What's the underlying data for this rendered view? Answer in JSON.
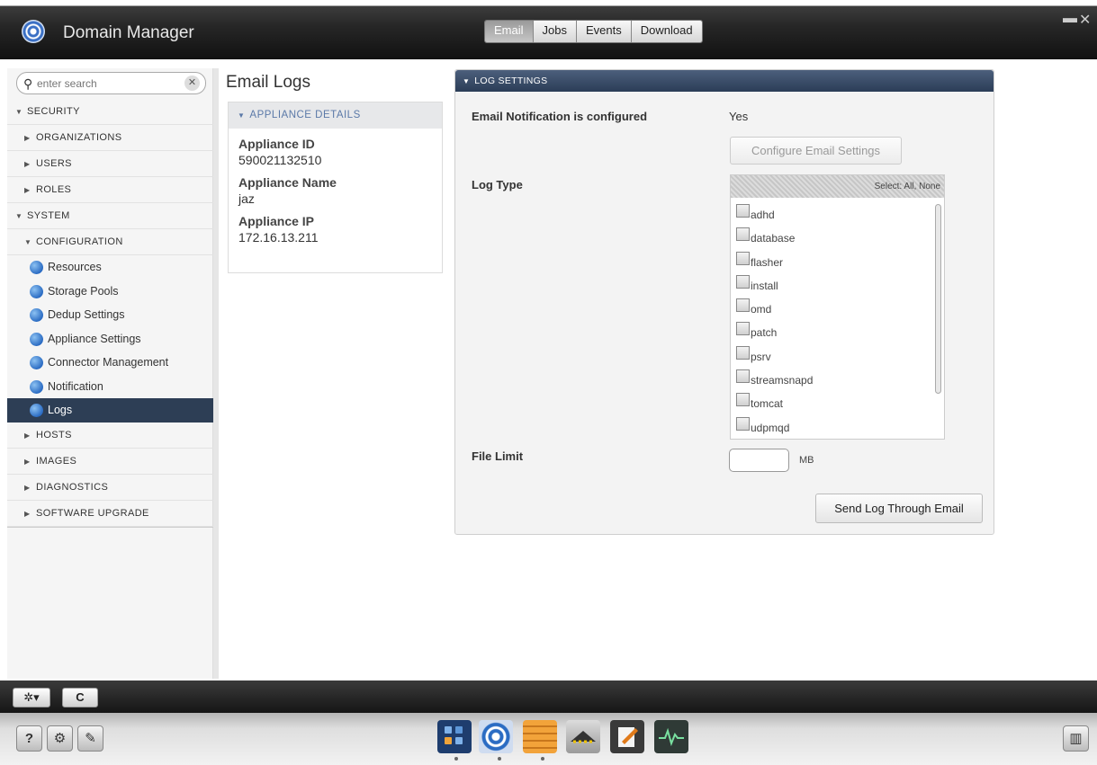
{
  "window": {
    "title": "Domain Manager"
  },
  "top_tabs": [
    {
      "label": "Email",
      "active": true
    },
    {
      "label": "Jobs",
      "active": false
    },
    {
      "label": "Events",
      "active": false
    },
    {
      "label": "Download",
      "active": false
    }
  ],
  "window_controls": {
    "minimize": "▬",
    "close": "✕"
  },
  "search": {
    "placeholder": "enter search",
    "clear_glyph": "✕"
  },
  "nav": {
    "security": "SECURITY",
    "organizations": "ORGANIZATIONS",
    "users": "USERS",
    "roles": "ROLES",
    "system": "SYSTEM",
    "configuration": "CONFIGURATION",
    "config_items": [
      "Resources",
      "Storage Pools",
      "Dedup Settings",
      "Appliance Settings",
      "Connector Management",
      "Notification",
      "Logs"
    ],
    "selected_item": "Logs",
    "hosts": "HOSTS",
    "images": "IMAGES",
    "diagnostics": "DIAGNOSTICS",
    "software_upgrade": "SOFTWARE UPGRADE"
  },
  "page": {
    "title": "Email Logs"
  },
  "appliance_details": {
    "header": "APPLIANCE DETAILS",
    "id_label": "Appliance ID",
    "id_value": "590021132510",
    "name_label": "Appliance Name",
    "name_value": "jaz",
    "ip_label": "Appliance IP",
    "ip_value": "172.16.13.211"
  },
  "log_settings": {
    "header": "LOG SETTINGS",
    "notify_label": "Email Notification is configured",
    "notify_value": "Yes",
    "configure_button": "Configure Email Settings",
    "log_type_label": "Log Type",
    "select_links": "Select: All, None",
    "log_types": [
      "adhd",
      "database",
      "flasher",
      "install",
      "omd",
      "patch",
      "psrv",
      "streamsnapd",
      "tomcat",
      "udpmqd"
    ],
    "file_limit_label": "File Limit",
    "file_limit_value": "",
    "file_limit_unit": "MB",
    "send_button": "Send Log Through Email"
  },
  "toolbar": {
    "settings_glyph": "✲▾",
    "refresh_glyph": "C"
  },
  "dock": {
    "help_glyph": "?",
    "gear_glyph": "⚙",
    "leaf_glyph": "✎",
    "book_glyph": "▥"
  },
  "colors": {
    "nav_selected": "#2d3e55",
    "panel_header": "#34465f",
    "accent_text": "#5b79a8"
  }
}
